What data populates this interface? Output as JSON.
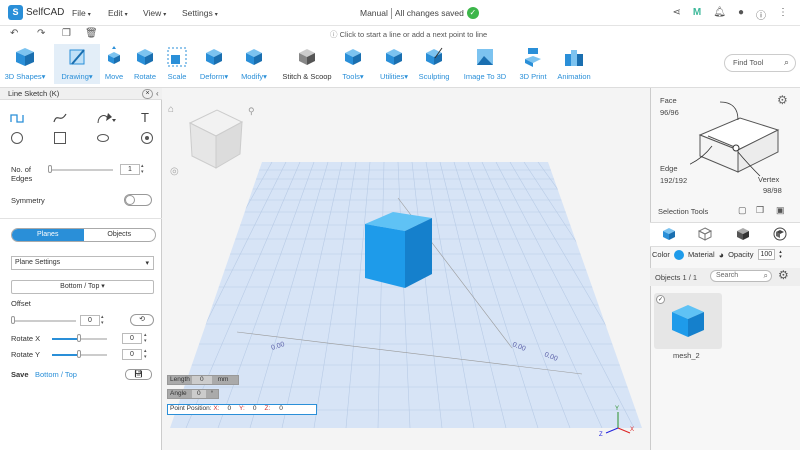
{
  "app": {
    "name": "SelfCAD"
  },
  "menu": [
    {
      "label": "File"
    },
    {
      "label": "Edit"
    },
    {
      "label": "View"
    },
    {
      "label": "Settings"
    }
  ],
  "header": {
    "mode": "Manual",
    "save_status": "All changes saved"
  },
  "hint": "Click to start a line or add a next point to line",
  "tools": [
    {
      "label": "3D Shapes",
      "dropdown": true
    },
    {
      "label": "Drawing",
      "dropdown": true
    },
    {
      "label": "Move"
    },
    {
      "label": "Rotate"
    },
    {
      "label": "Scale"
    },
    {
      "label": "Deform",
      "dropdown": true
    },
    {
      "label": "Modify",
      "dropdown": true
    },
    {
      "label": "Stitch & Scoop"
    },
    {
      "label": "Tools",
      "dropdown": true
    },
    {
      "label": "Utilities",
      "dropdown": true
    },
    {
      "label": "Sculpting"
    },
    {
      "label": "Image To 3D"
    },
    {
      "label": "3D Print"
    },
    {
      "label": "Animation"
    }
  ],
  "find_tool": {
    "placeholder": "Find Tool"
  },
  "left_panel": {
    "title": "Line Sketch (K)",
    "edges_label_1": "No. of",
    "edges_label_2": "Edges",
    "edges_value": "1",
    "symmetry_label": "Symmetry",
    "tabs": [
      "Planes",
      "Objects"
    ],
    "plane_settings": "Plane Settings",
    "plane_button": "Bottom / Top",
    "offset_label": "Offset",
    "offset_value": "0",
    "rotate_x_label": "Rotate X",
    "rotate_x_value": "0",
    "rotate_y_label": "Rotate Y",
    "rotate_y_value": "0",
    "save_label": "Save",
    "save_target": "Bottom / Top"
  },
  "viewport": {
    "grid_labels": [
      "0.00",
      "0.00",
      "0.00"
    ],
    "length_label": "Length",
    "length_value": "0",
    "length_unit": "mm",
    "angle_label": "Angle",
    "angle_value": "0",
    "angle_unit": "°",
    "point_label": "Point Position:",
    "x_label": "X:",
    "x_value": "0",
    "y_label": "Y:",
    "y_value": "0",
    "z_label": "Z:",
    "z_value": "0",
    "axes": {
      "x": "X",
      "y": "Y",
      "z": "Z"
    }
  },
  "right_panel": {
    "face_label": "Face",
    "face_count": "96/96",
    "edge_label": "Edge",
    "edge_count": "192/192",
    "vertex_label": "Vertex",
    "vertex_count": "98/98",
    "selection_tools": "Selection Tools",
    "color_label": "Color",
    "material_label": "Material",
    "opacity_label": "Opacity",
    "opacity_value": "100",
    "objects_label": "Objects 1 / 1",
    "search_placeholder": "Search",
    "object_name": "mesh_2"
  },
  "colors": {
    "accent": "#2a8fd8",
    "cube": "#1e9bea",
    "ok": "#3cb64a"
  }
}
